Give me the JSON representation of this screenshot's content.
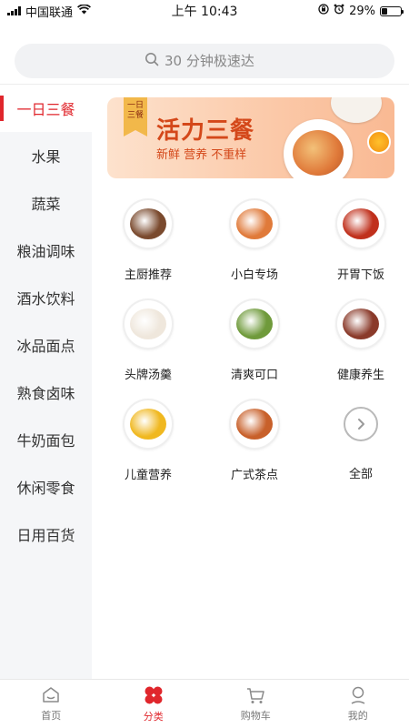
{
  "status_bar": {
    "carrier": "中国联通",
    "time": "上午 10:43",
    "battery": "29%",
    "battery_level": 0.29
  },
  "search": {
    "placeholder": "30 分钟极速达"
  },
  "sidebar": {
    "active_index": 0,
    "items": [
      {
        "label": "一日三餐"
      },
      {
        "label": "水果"
      },
      {
        "label": "蔬菜"
      },
      {
        "label": "粮油调味"
      },
      {
        "label": "酒水饮料"
      },
      {
        "label": "冰品面点"
      },
      {
        "label": "熟食卤味"
      },
      {
        "label": "牛奶面包"
      },
      {
        "label": "休闲零食"
      },
      {
        "label": "日用百货"
      }
    ]
  },
  "banner": {
    "tag": "一日三餐",
    "title": "活力三餐",
    "subtitle": "新鲜 营养 不重样"
  },
  "categories": [
    {
      "label": "主厨推荐",
      "icon": "steak-dish-icon",
      "color": "#7a4a2e"
    },
    {
      "label": "小白专场",
      "icon": "shrimp-dish-icon",
      "color": "#e07a3a"
    },
    {
      "label": "开胃下饭",
      "icon": "spicy-soup-icon",
      "color": "#c0301c"
    },
    {
      "label": "头牌汤羹",
      "icon": "soup-bowl-icon",
      "color": "#efe7dc"
    },
    {
      "label": "清爽可口",
      "icon": "salad-icon",
      "color": "#6f9a3b"
    },
    {
      "label": "健康养生",
      "icon": "hotpot-icon",
      "color": "#8a3a2a"
    },
    {
      "label": "儿童营养",
      "icon": "fruit-plate-icon",
      "color": "#f0b820"
    },
    {
      "label": "广式茶点",
      "icon": "chicken-feet-icon",
      "color": "#c8602a"
    },
    {
      "label": "全部",
      "icon": "chevron-right-icon"
    }
  ],
  "tabbar": {
    "active_index": 1,
    "items": [
      {
        "label": "首页",
        "icon": "home-icon"
      },
      {
        "label": "分类",
        "icon": "category-icon"
      },
      {
        "label": "购物车",
        "icon": "cart-icon"
      },
      {
        "label": "我的",
        "icon": "profile-icon"
      }
    ]
  },
  "colors": {
    "accent": "#e0262c",
    "banner_text": "#d4481a"
  }
}
